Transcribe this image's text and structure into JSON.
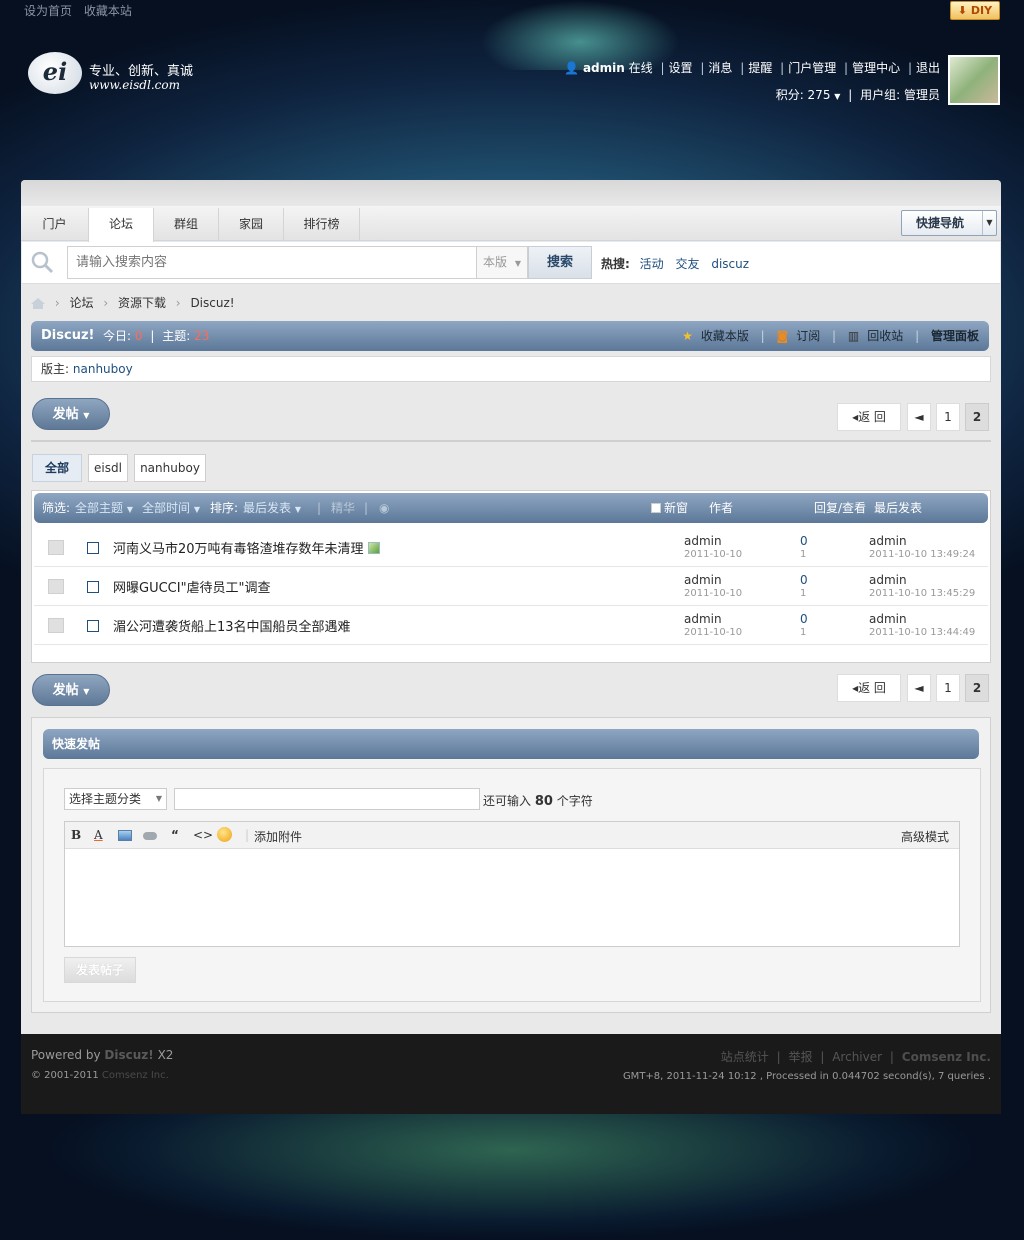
{
  "header": {
    "top_links": [
      "设为首页",
      "收藏本站"
    ],
    "diy_label": "DIY",
    "logo_slogan": "专业、创新、真诚",
    "logo_url": "www.eisdl.com",
    "logo_mark": "ei",
    "user": {
      "name": "admin",
      "status": "在线",
      "links": [
        "设置",
        "消息",
        "提醒",
        "门户管理",
        "管理中心",
        "退出"
      ],
      "points_label": "积分: 275",
      "group_label": "用户组: 管理员"
    }
  },
  "nav": {
    "tabs": [
      "门户",
      "论坛",
      "群组",
      "家园",
      "排行榜"
    ],
    "active_tab": "论坛",
    "quick_nav": "快捷导航"
  },
  "search": {
    "placeholder": "请输入搜索内容",
    "scope": "本版",
    "button": "搜索",
    "hot_label": "热搜:",
    "hot_terms": [
      "活动",
      "交友",
      "discuz"
    ]
  },
  "breadcrumb": [
    "论坛",
    "资源下载",
    "Discuz!"
  ],
  "forum": {
    "name": "Discuz!",
    "today_label": "今日:",
    "today": "0",
    "threads_label": "主题:",
    "threads": "23",
    "actions": [
      "收藏本版",
      "订阅",
      "回收站",
      "管理面板"
    ],
    "moderator_label": "版主:",
    "moderator": "nanhuboy"
  },
  "post_button": "发帖",
  "pager": {
    "back": "返 回",
    "prev": "◄",
    "pages": [
      "1",
      "2"
    ],
    "current": "2"
  },
  "filter_tabs": [
    "全部",
    "eisdl",
    "nanhuboy"
  ],
  "list_header": {
    "filter_label": "筛选:",
    "all_threads": "全部主题",
    "all_time": "全部时间",
    "sort_label": "排序:",
    "latest": "最后发表",
    "digest": "精华",
    "new_window": "新窗",
    "author": "作者",
    "reply_view": "回复/查看",
    "last_post": "最后发表"
  },
  "threads": [
    {
      "title": "河南义马市20万吨有毒铬渣堆存数年未清理",
      "author": "admin",
      "date": "2011-10-10",
      "replies": "0",
      "views": "1",
      "last_author": "admin",
      "last_date": "2011-10-10 13:49:24",
      "has_image": true
    },
    {
      "title": "网曝GUCCI\"虐待员工\"调查",
      "author": "admin",
      "date": "2011-10-10",
      "replies": "0",
      "views": "1",
      "last_author": "admin",
      "last_date": "2011-10-10 13:45:29",
      "has_image": false
    },
    {
      "title": "湄公河遭袭货船上13名中国船员全部遇难",
      "author": "admin",
      "date": "2011-10-10",
      "replies": "0",
      "views": "1",
      "last_author": "admin",
      "last_date": "2011-10-10 13:44:49",
      "has_image": false
    }
  ],
  "quick_post": {
    "title": "快速发帖",
    "category_select": "选择主题分类",
    "remain_prefix": "还可输入",
    "remain_count": "80",
    "remain_suffix": "个字符",
    "toolbar": {
      "bold": "B",
      "font_color": "A",
      "quote": "“",
      "code": "<>",
      "attach": "添加附件",
      "advanced": "高级模式"
    },
    "submit": "发表帖子"
  },
  "footer": {
    "powered_prefix": "Powered by",
    "powered_brand": "Discuz!",
    "powered_version": "X2",
    "copyright": "© 2001-2011",
    "company": "Comsenz Inc.",
    "links": [
      "站点统计",
      "举报",
      "Archiver"
    ],
    "brand_right": "Comsenz Inc.",
    "info": "GMT+8, 2011-11-24 10:12 , Processed in 0.044702 second(s), 7 queries ."
  }
}
